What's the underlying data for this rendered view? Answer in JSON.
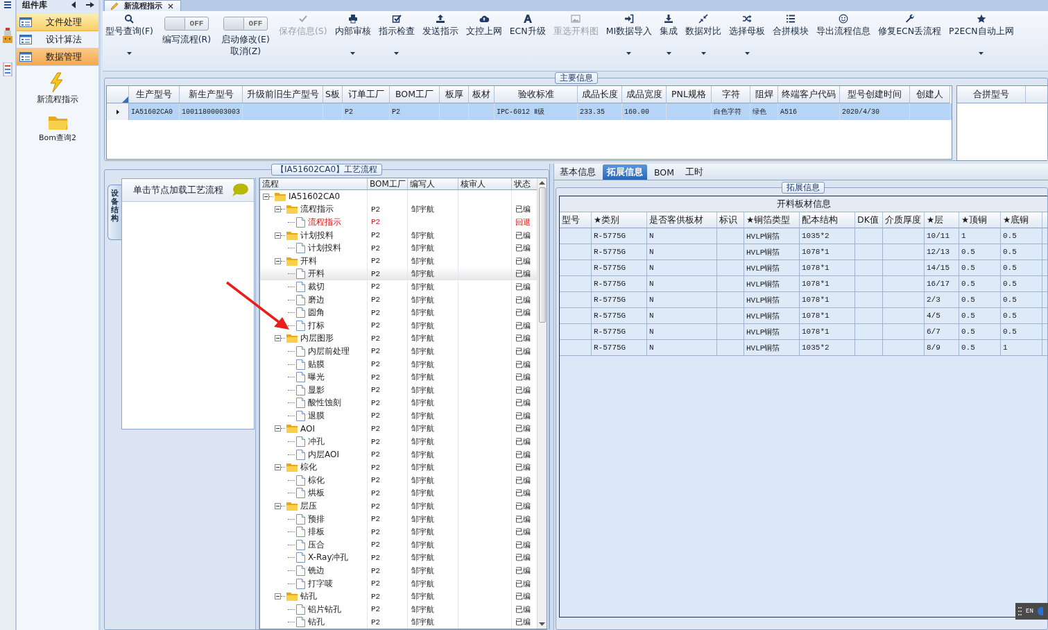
{
  "app_tab": {
    "label": "新流程指示"
  },
  "sidebar": {
    "title": "组件库",
    "items": [
      {
        "label": "文件处理",
        "selected": false,
        "highlighted": true
      },
      {
        "label": "设计算法",
        "selected": false,
        "highlighted": false
      },
      {
        "label": "数据管理",
        "selected": true,
        "highlighted": false
      }
    ],
    "launchers": [
      {
        "label": "新流程指示"
      },
      {
        "label": "Bom查询2"
      }
    ]
  },
  "toolbar": {
    "items": [
      {
        "kind": "button",
        "label": "型号查询(F)",
        "dropdown": true,
        "disabled": false
      },
      {
        "kind": "toggle",
        "switch_text": "OFF",
        "on": false,
        "label": "编写流程(R)"
      },
      {
        "kind": "toggle",
        "switch_text": "OFF",
        "on": false,
        "label": "启动修改(E) 取消(Z)"
      },
      {
        "kind": "button",
        "label": "保存信息(S)",
        "dropdown": false,
        "disabled": true
      },
      {
        "kind": "button",
        "label": "内部审核",
        "dropdown": true,
        "disabled": false
      },
      {
        "kind": "button",
        "label": "指示检查",
        "dropdown": true,
        "disabled": false
      },
      {
        "kind": "button",
        "label": "发送指示",
        "dropdown": false,
        "disabled": false
      },
      {
        "kind": "button",
        "label": "文控上网",
        "dropdown": false,
        "disabled": false
      },
      {
        "kind": "button",
        "label": "ECN升级",
        "dropdown": false,
        "disabled": false
      },
      {
        "kind": "button",
        "label": "重选开料图",
        "dropdown": false,
        "disabled": true
      },
      {
        "kind": "button",
        "label": "MI数据导入",
        "dropdown": true,
        "disabled": false
      },
      {
        "kind": "button",
        "label": "集成",
        "dropdown": true,
        "disabled": false
      },
      {
        "kind": "button",
        "label": "数据对比",
        "dropdown": true,
        "disabled": false
      },
      {
        "kind": "button",
        "label": "选择母板",
        "dropdown": true,
        "disabled": false
      },
      {
        "kind": "button",
        "label": "合拼模块",
        "dropdown": false,
        "disabled": false
      },
      {
        "kind": "button",
        "label": "导出流程信息",
        "dropdown": false,
        "disabled": false
      },
      {
        "kind": "button",
        "label": "修复ECN丢流程",
        "dropdown": false,
        "disabled": false
      },
      {
        "kind": "button",
        "label": "P2ECN自动上网",
        "dropdown": true,
        "disabled": false
      }
    ]
  },
  "main_info": {
    "legend": "主要信息",
    "columns": [
      "生产型号",
      "新生产型号",
      "升级前旧生产型号",
      "S板",
      "订单工厂",
      "BOM工厂",
      "板厚",
      "板材",
      "验收标准",
      "成品长度",
      "成品宽度",
      "PNL规格",
      "字符",
      "阻焊",
      "终端客户代码",
      "型号创建时间",
      "创建人"
    ],
    "rows": [
      {
        "selected": true,
        "cells": [
          "IA51602CA0",
          "10011800003003",
          null,
          null,
          "P2",
          "P2",
          null,
          null,
          "IPC-6012 Ⅱ级",
          "233.35",
          "160.00",
          null,
          "白色字符",
          "绿色",
          "A516",
          "2020/4/30",
          null
        ]
      }
    ],
    "side_columns": [
      "合拼型号",
      null
    ]
  },
  "process": {
    "legend": "【IA51602CA0】工艺流程",
    "side_tab": "设备结构",
    "hint": "单击节点加载工艺流程",
    "columns": [
      "流程",
      "BOM工厂",
      "编写人",
      "核审人",
      "状态"
    ],
    "tree": [
      {
        "name": "IA51602CA0",
        "expanded": true,
        "selected": false,
        "returned": false,
        "children": [
          {
            "name": "流程指示",
            "bom": "P2",
            "writer": "邹宇航",
            "status": "已编",
            "expanded": true,
            "selected": false,
            "returned": false,
            "children": [
              {
                "name": "流程指示",
                "bom": "P2",
                "status": "回退",
                "selected": false,
                "returned": true
              }
            ]
          },
          {
            "name": "计划投料",
            "bom": "P2",
            "writer": "邹宇航",
            "status": "已编",
            "expanded": true,
            "selected": false,
            "returned": false,
            "children": [
              {
                "name": "计划投料",
                "bom": "P2",
                "writer": "邹宇航",
                "status": "已编",
                "selected": false,
                "returned": false
              }
            ]
          },
          {
            "name": "开料",
            "bom": "P2",
            "writer": "邹宇航",
            "status": "已编",
            "expanded": true,
            "selected": false,
            "returned": false,
            "children": [
              {
                "name": "开料",
                "bom": "P2",
                "writer": "邹宇航",
                "status": "已编",
                "selected": true,
                "returned": false
              },
              {
                "name": "裁切",
                "bom": "P2",
                "writer": "邹宇航",
                "status": "已编",
                "selected": false,
                "returned": false
              },
              {
                "name": "磨边",
                "bom": "P2",
                "writer": "邹宇航",
                "status": "已编",
                "selected": false,
                "returned": false
              },
              {
                "name": "圆角",
                "bom": "P2",
                "writer": "邹宇航",
                "status": "已编",
                "selected": false,
                "returned": false
              },
              {
                "name": "打标",
                "bom": "P2",
                "writer": "邹宇航",
                "status": "已编",
                "selected": false,
                "returned": false
              }
            ]
          },
          {
            "name": "内层图形",
            "bom": "P2",
            "writer": "邹宇航",
            "status": "已编",
            "expanded": true,
            "selected": false,
            "returned": false,
            "children": [
              {
                "name": "内层前处理",
                "bom": "P2",
                "writer": "邹宇航",
                "status": "已编",
                "selected": false,
                "returned": false
              },
              {
                "name": "贴膜",
                "bom": "P2",
                "writer": "邹宇航",
                "status": "已编",
                "selected": false,
                "returned": false
              },
              {
                "name": "曝光",
                "bom": "P2",
                "writer": "邹宇航",
                "status": "已编",
                "selected": false,
                "returned": false
              },
              {
                "name": "显影",
                "bom": "P2",
                "writer": "邹宇航",
                "status": "已编",
                "selected": false,
                "returned": false
              },
              {
                "name": "酸性蚀刻",
                "bom": "P2",
                "writer": "邹宇航",
                "status": "已编",
                "selected": false,
                "returned": false
              },
              {
                "name": "退膜",
                "bom": "P2",
                "writer": "邹宇航",
                "status": "已编",
                "selected": false,
                "returned": false
              }
            ]
          },
          {
            "name": "AOI",
            "bom": "P2",
            "writer": "邹宇航",
            "status": "已编",
            "expanded": true,
            "selected": false,
            "returned": false,
            "children": [
              {
                "name": "冲孔",
                "bom": "P2",
                "writer": "邹宇航",
                "status": "已编",
                "selected": false,
                "returned": false
              },
              {
                "name": "内层AOI",
                "bom": "P2",
                "writer": "邹宇航",
                "status": "已编",
                "selected": false,
                "returned": false
              }
            ]
          },
          {
            "name": "棕化",
            "bom": "P2",
            "writer": "邹宇航",
            "status": "已编",
            "expanded": true,
            "selected": false,
            "returned": false,
            "children": [
              {
                "name": "棕化",
                "bom": "P2",
                "writer": "邹宇航",
                "status": "已编",
                "selected": false,
                "returned": false
              },
              {
                "name": "烘板",
                "bom": "P2",
                "writer": "邹宇航",
                "status": "已编",
                "selected": false,
                "returned": false
              }
            ]
          },
          {
            "name": "层压",
            "bom": "P2",
            "writer": "邹宇航",
            "status": "已编",
            "expanded": true,
            "selected": false,
            "returned": false,
            "children": [
              {
                "name": "预排",
                "bom": "P2",
                "writer": "邹宇航",
                "status": "已编",
                "selected": false,
                "returned": false
              },
              {
                "name": "排板",
                "bom": "P2",
                "writer": "邹宇航",
                "status": "已编",
                "selected": false,
                "returned": false
              },
              {
                "name": "压合",
                "bom": "P2",
                "writer": "邹宇航",
                "status": "已编",
                "selected": false,
                "returned": false
              },
              {
                "name": "X-Ray冲孔",
                "bom": "P2",
                "writer": "邹宇航",
                "status": "已编",
                "selected": false,
                "returned": false
              },
              {
                "name": "铣边",
                "bom": "P2",
                "writer": "邹宇航",
                "status": "已编",
                "selected": false,
                "returned": false
              },
              {
                "name": "打字唛",
                "bom": "P2",
                "writer": "邹宇航",
                "status": "已编",
                "selected": false,
                "returned": false
              }
            ]
          },
          {
            "name": "钻孔",
            "bom": "P2",
            "writer": "邹宇航",
            "status": "已编",
            "expanded": true,
            "selected": false,
            "returned": false,
            "children": [
              {
                "name": "铝片钻孔",
                "bom": "P2",
                "writer": "邹宇航",
                "status": "已编",
                "selected": false,
                "returned": false
              },
              {
                "name": "钻孔",
                "bom": "P2",
                "writer": "邹宇航",
                "status": "已编",
                "selected": false,
                "returned": false
              }
            ]
          }
        ]
      }
    ]
  },
  "detail": {
    "tabs": [
      {
        "label": "基本信息",
        "selected": false
      },
      {
        "label": "拓展信息",
        "selected": true
      },
      {
        "label": "BOM",
        "selected": false
      },
      {
        "label": "工时",
        "selected": false
      }
    ],
    "legend": "拓展信息",
    "grid": {
      "caption": "开料板材信息",
      "columns": [
        "型号",
        "★类别",
        "是否客供板材",
        "标识",
        "★铜箔类型",
        "配本结构",
        "DK值",
        "介质厚度",
        "★层",
        "★顶铜",
        "★底铜",
        null
      ],
      "rows": [
        [
          null,
          "R-5775G",
          "N",
          null,
          "HVLP铜箔",
          "1035*2",
          null,
          null,
          "10/11",
          "1",
          "0.5",
          null
        ],
        [
          null,
          "R-5775G",
          "N",
          null,
          "HVLP铜箔",
          "1078*1",
          null,
          null,
          "12/13",
          "0.5",
          "0.5",
          null
        ],
        [
          null,
          "R-5775G",
          "N",
          null,
          "HVLP铜箔",
          "1078*1",
          null,
          null,
          "14/15",
          "0.5",
          "0.5",
          null
        ],
        [
          null,
          "R-5775G",
          "N",
          null,
          "HVLP铜箔",
          "1078*1",
          null,
          null,
          "16/17",
          "0.5",
          "0.5",
          null
        ],
        [
          null,
          "R-5775G",
          "N",
          null,
          "HVLP铜箔",
          "1078*1",
          null,
          null,
          "2/3",
          "0.5",
          "0.5",
          null
        ],
        [
          null,
          "R-5775G",
          "N",
          null,
          "HVLP铜箔",
          "1078*1",
          null,
          null,
          "4/5",
          "0.5",
          "0.5",
          null
        ],
        [
          null,
          "R-5775G",
          "N",
          null,
          "HVLP铜箔",
          "1078*1",
          null,
          null,
          "6/7",
          "0.5",
          "0.5",
          null
        ],
        [
          null,
          "R-5775G",
          "N",
          null,
          "HVLP铜箔",
          "1035*2",
          null,
          null,
          "8/9",
          "0.5",
          "1",
          null
        ]
      ]
    }
  },
  "ime": "EN"
}
